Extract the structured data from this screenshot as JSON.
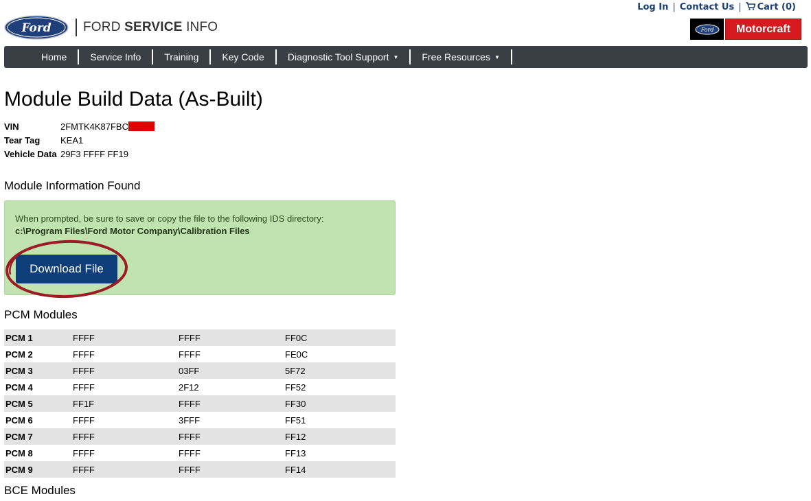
{
  "header": {
    "top_links": {
      "login": "Log In",
      "contact": "Contact Us",
      "cart": "Cart (0)",
      "separator": "|"
    },
    "ford_logo_text": "Ford",
    "brand_light": "FORD ",
    "brand_bold": "SERVICE",
    "brand_suffix": " INFO",
    "motorcraft_ford_text": "Ford",
    "motorcraft_label": "Motorcraft",
    "colors": {
      "link": "#1a3f74",
      "motorcraft_red": "#d71920",
      "ford_blue": "#1f3f7a"
    }
  },
  "nav": {
    "items": [
      {
        "label": "Home",
        "has_dropdown": false
      },
      {
        "label": "Service Info",
        "has_dropdown": false
      },
      {
        "label": "Training",
        "has_dropdown": false
      },
      {
        "label": "Key Code",
        "has_dropdown": false
      },
      {
        "label": "Diagnostic Tool Support",
        "has_dropdown": true
      },
      {
        "label": "Free Resources",
        "has_dropdown": true
      }
    ],
    "caret": "▼",
    "background": "#3a3f45"
  },
  "main": {
    "title": "Module Build Data (As-Built)",
    "vehicle_info": [
      {
        "label": "VIN",
        "value": "2FMTK4K87FBC",
        "redacted": true
      },
      {
        "label": "Tear Tag",
        "value": "KEA1"
      },
      {
        "label": "Vehicle Data",
        "value": "29F3 FFFF FF19"
      }
    ],
    "module_info_heading": "Module Information Found",
    "alert": {
      "message": "When prompted, be sure to save or copy the file to the following IDS directory:",
      "path": "c:\\Program Files\\Ford Motor Company\\Calibration Files",
      "button_label": "Download File",
      "background": "#c1e3b0",
      "button_color": "#0e3e7a",
      "annotation_color": "#9b1c24"
    },
    "pcm_heading": "PCM Modules",
    "pcm_rows": [
      {
        "name": "PCM 1",
        "c1": "FFFF",
        "c2": "FFFF",
        "c3": "FF0C"
      },
      {
        "name": "PCM 2",
        "c1": "FFFF",
        "c2": "FFFF",
        "c3": "FE0C"
      },
      {
        "name": "PCM 3",
        "c1": "FFFF",
        "c2": "03FF",
        "c3": "5F72"
      },
      {
        "name": "PCM 4",
        "c1": "FFFF",
        "c2": "2F12",
        "c3": "FF52"
      },
      {
        "name": "PCM 5",
        "c1": "FF1F",
        "c2": "FFFF",
        "c3": "FF30"
      },
      {
        "name": "PCM 6",
        "c1": "FFFF",
        "c2": "3FFF",
        "c3": "FF51"
      },
      {
        "name": "PCM 7",
        "c1": "FFFF",
        "c2": "FFFF",
        "c3": "FF12"
      },
      {
        "name": "PCM 8",
        "c1": "FFFF",
        "c2": "FFFF",
        "c3": "FF13"
      },
      {
        "name": "PCM 9",
        "c1": "FFFF",
        "c2": "FFFF",
        "c3": "FF14"
      }
    ],
    "bce_heading": "BCE Modules"
  }
}
